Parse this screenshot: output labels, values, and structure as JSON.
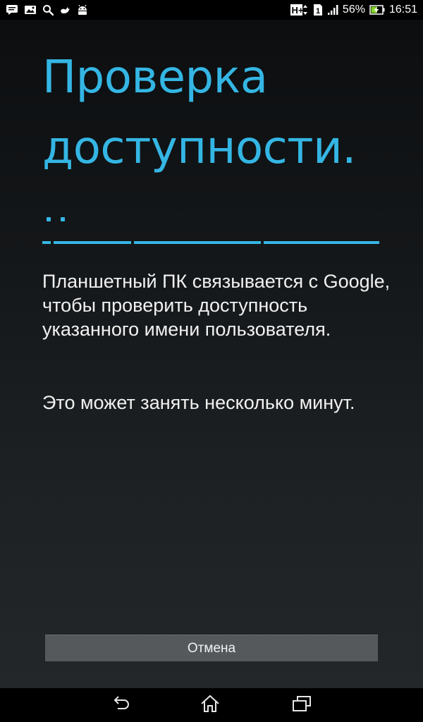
{
  "status_bar": {
    "left_icons": [
      "chat-notification-icon",
      "gallery-notification-icon",
      "search-notification-icon",
      "bird-notification-icon",
      "android-notification-icon"
    ],
    "network_type": "H+",
    "sim_slot": "1",
    "battery_percent": "56%",
    "time": "16:51",
    "battery_level": 0.56,
    "battery_charging": true
  },
  "screen": {
    "title": "Проверка доступности.",
    "progress": {
      "style": "indeterminate",
      "dot_count": 2
    },
    "paragraphs": [
      "Планшетный ПК связывается с Google, чтобы проверить доступность указанного имени пользователя.",
      "Это может занять несколько минут."
    ],
    "cancel_label": "Отмена"
  },
  "navigation": {
    "buttons": [
      "back-icon",
      "home-icon",
      "recent-apps-icon"
    ]
  },
  "colors": {
    "accent": "#34b6e4",
    "text": "#f1f1f1",
    "button_bg": "#56595c",
    "status_bar_bg": "#000000"
  }
}
